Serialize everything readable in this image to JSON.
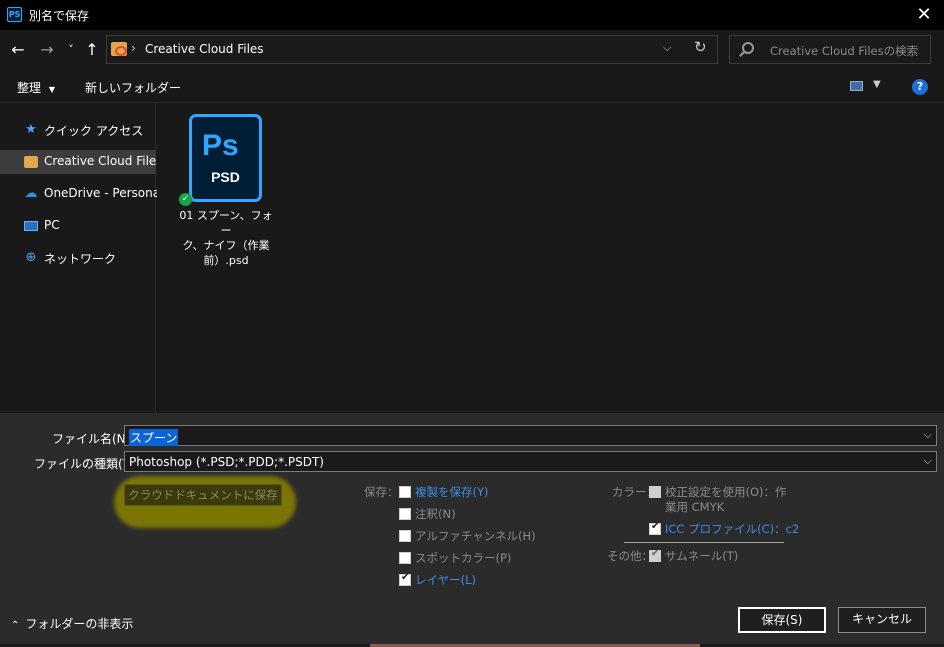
{
  "window": {
    "title": "別名で保存",
    "app_icon": "PS"
  },
  "nav": {
    "back": "←",
    "forward": "→",
    "recent": "˅",
    "up": "↑",
    "path_separator": "›",
    "path": "Creative Cloud Files",
    "dropdown": "⌵",
    "refresh": "↻",
    "search_placeholder": "Creative Cloud Filesの検索"
  },
  "toolbar": {
    "organize": "整理",
    "organize_arrow": "▼",
    "new_folder": "新しいフォルダー",
    "view_arrow": "▼",
    "help": "?"
  },
  "sidebar": {
    "items": [
      {
        "label": "クイック アクセス",
        "icon": "star-icon",
        "selected": false
      },
      {
        "label": "Creative Cloud Files",
        "icon": "cc-folder-icon",
        "selected": true
      },
      {
        "label": "OneDrive - Personal",
        "icon": "cloud-icon",
        "selected": false
      },
      {
        "label": "PC",
        "icon": "pc-icon",
        "selected": false
      },
      {
        "label": "ネットワーク",
        "icon": "network-icon",
        "selected": false
      }
    ]
  },
  "files": [
    {
      "name_line1": "01 スプーン、フォー",
      "name_line2": "ク、ナイフ（作業",
      "name_line3": "前）.psd",
      "icon_top": "Ps",
      "icon_label": "PSD",
      "status": "synced"
    }
  ],
  "form": {
    "filename_label": "ファイル名(N):",
    "filename_value": "スプーン",
    "filetype_label": "ファイルの種類(T):",
    "filetype_value": "Photoshop (*.PSD;*.PDD;*.PSDT)",
    "cloud_button": "クラウドドキュメントに保存"
  },
  "save_options": {
    "caption": "保存：",
    "items": [
      {
        "label": "複製を保存(Y)",
        "checked": false,
        "highlight": true
      },
      {
        "label": "注釈(N)",
        "checked": false,
        "highlight": false
      },
      {
        "label": "アルファチャンネル(H)",
        "checked": false,
        "highlight": false
      },
      {
        "label": "スポットカラー(P)",
        "checked": false,
        "highlight": false
      },
      {
        "label": "レイヤー(L)",
        "checked": true,
        "highlight": true
      }
    ]
  },
  "color_options": {
    "caption": "カラー：",
    "proof_line1": "校正設定を使用(O)：作",
    "proof_line2": "業用 CMYK",
    "proof_checked": false,
    "icc_label": "ICC プロファイル(C)：c2",
    "icc_checked": true
  },
  "other_options": {
    "caption": "その他：",
    "thumbnail_label": "サムネール(T)",
    "thumbnail_checked": true
  },
  "footer": {
    "hide_folders": "フォルダーの非表示",
    "hide_arrow": "⌃",
    "save": "保存(S)",
    "cancel": "キャンセル"
  },
  "colors": {
    "accent": "#0a64d6",
    "ps_blue": "#31a8ff",
    "highlight": "#8a8200"
  }
}
